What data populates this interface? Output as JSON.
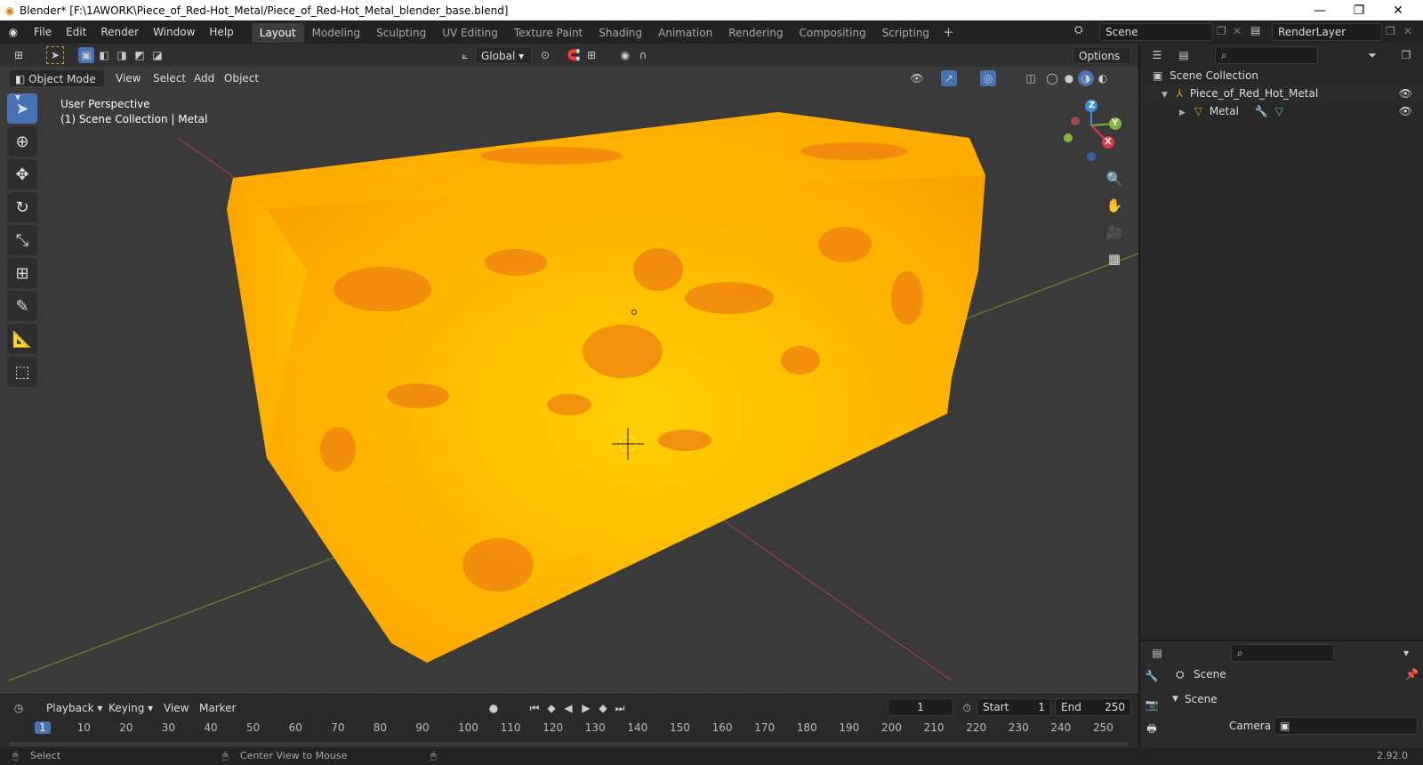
{
  "titlebar": {
    "title": "Blender* [F:\\1AWORK\\Piece_of_Red-Hot_Metal/Piece_of_Red-Hot_Metal_blender_base.blend]",
    "minimize": "—",
    "restore": "❐",
    "close": "✕"
  },
  "menus": [
    "File",
    "Edit",
    "Render",
    "Window",
    "Help"
  ],
  "workspaces": [
    "Layout",
    "Modeling",
    "Sculpting",
    "UV Editing",
    "Texture Paint",
    "Shading",
    "Animation",
    "Rendering",
    "Compositing",
    "Scripting"
  ],
  "scene_selector": "Scene",
  "render_layer": "RenderLayer",
  "tool_header": {
    "transform_orientation": "Global",
    "options": "Options"
  },
  "view_header": {
    "mode": "Object Mode",
    "menus": [
      "View",
      "Select",
      "Add",
      "Object"
    ]
  },
  "viewport": {
    "perspective_label": "User Perspective",
    "collection_label": "(1) Scene Collection | Metal",
    "gizmo_axes": [
      "Z",
      "Y",
      "X"
    ],
    "colors": {
      "x": "#e03a4a",
      "y": "#7fb33a",
      "z": "#3a8ee0",
      "metal_base": "#ffb000",
      "metal_spots": "#f07f10"
    }
  },
  "outliner": {
    "root": "Scene Collection",
    "items": [
      {
        "label": "Piece_of_Red_Hot_Metal"
      },
      {
        "label": "Metal"
      }
    ]
  },
  "properties": {
    "header": "Scene",
    "section": "Scene",
    "camera_label": "Camera"
  },
  "timeline": {
    "menus": [
      "Playback",
      "Keying",
      "View",
      "Marker"
    ],
    "current_frame": "1",
    "start_label": "Start",
    "start_value": "1",
    "end_label": "End",
    "end_value": "250",
    "ruler": [
      "1",
      "10",
      "20",
      "30",
      "40",
      "50",
      "60",
      "70",
      "80",
      "90",
      "100",
      "110",
      "120",
      "130",
      "140",
      "150",
      "160",
      "170",
      "180",
      "190",
      "200",
      "210",
      "220",
      "230",
      "240",
      "250"
    ]
  },
  "statusbar": {
    "select": "Select",
    "center_view": "Center View to Mouse",
    "version": "2.92.0"
  }
}
